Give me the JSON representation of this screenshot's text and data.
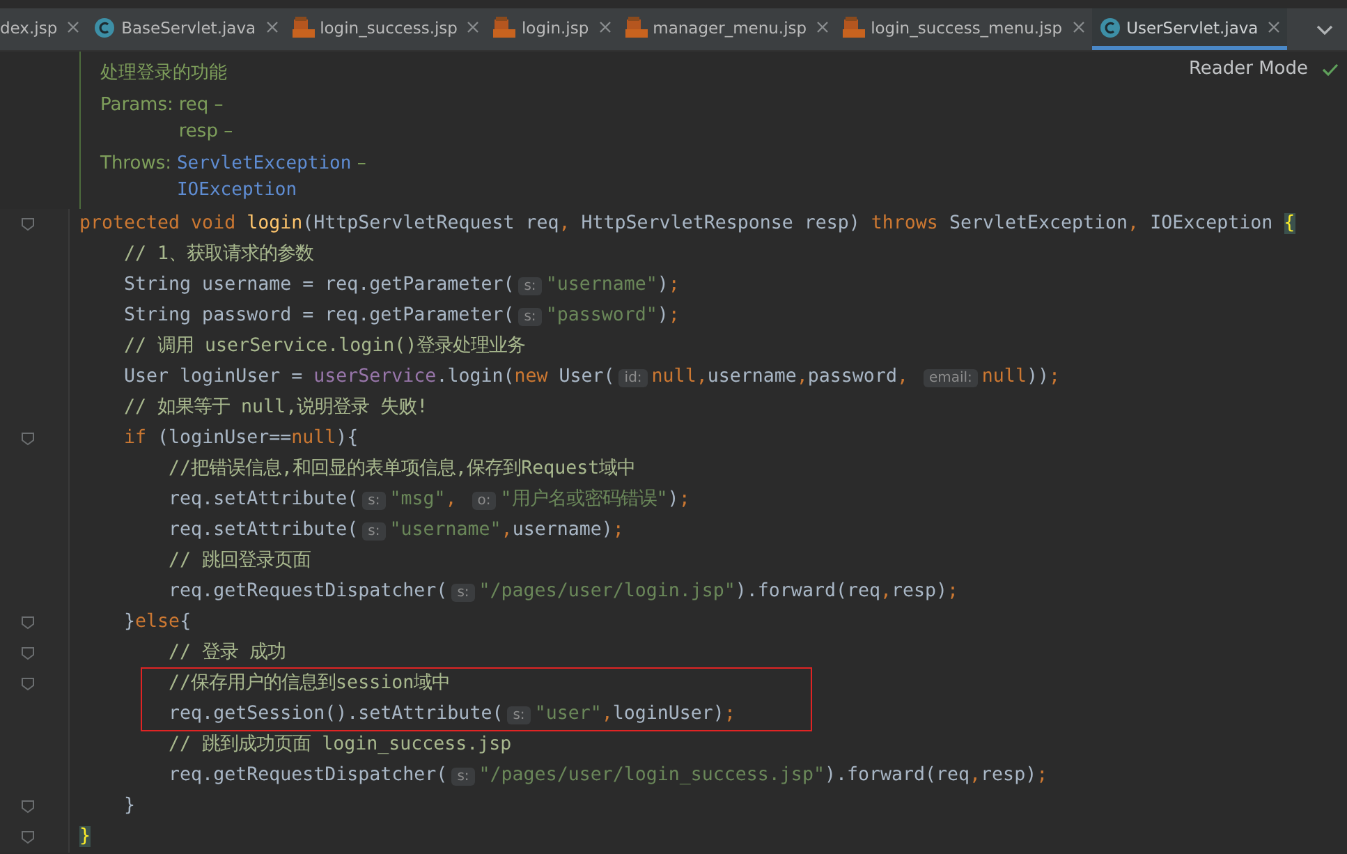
{
  "tabs": [
    {
      "label": "dex.jsp",
      "kind": "plain",
      "selected": false
    },
    {
      "label": "BaseServlet.java",
      "kind": "java",
      "selected": false
    },
    {
      "label": "login_success.jsp",
      "kind": "jsp",
      "selected": false
    },
    {
      "label": "login.jsp",
      "kind": "jsp",
      "selected": false
    },
    {
      "label": "manager_menu.jsp",
      "kind": "jsp",
      "selected": false
    },
    {
      "label": "login_success_menu.jsp",
      "kind": "jsp",
      "selected": false
    },
    {
      "label": "UserServlet.java",
      "kind": "java",
      "selected": true
    }
  ],
  "reader_mode": "Reader Mode",
  "doc": {
    "summary": "处理登录的功能",
    "params_label": "Params:",
    "params": [
      "req –",
      "resp –"
    ],
    "throws_label": "Throws:",
    "throws": [
      {
        "name": "ServletException",
        "suffix": " –"
      },
      {
        "name": "IOException",
        "suffix": ""
      }
    ]
  },
  "lines": [
    {
      "fold": true,
      "boxed": false,
      "tokens": [
        {
          "kind": "kw",
          "text": "protected void "
        },
        {
          "kind": "fn",
          "text": "login"
        },
        {
          "kind": "plain",
          "text": "(HttpServletRequest req"
        },
        {
          "kind": "punct",
          "text": ", "
        },
        {
          "kind": "plain",
          "text": "HttpServletResponse resp) "
        },
        {
          "kind": "kw",
          "text": "throws "
        },
        {
          "kind": "plain",
          "text": "ServletException"
        },
        {
          "kind": "punct",
          "text": ", "
        },
        {
          "kind": "plain",
          "text": "IOException "
        },
        {
          "kind": "match",
          "text": "{"
        }
      ]
    },
    {
      "fold": false,
      "boxed": false,
      "tokens": [
        {
          "kind": "cm",
          "text": "    // 1、获取请求的参数"
        }
      ]
    },
    {
      "fold": false,
      "boxed": false,
      "tokens": [
        {
          "kind": "plain",
          "text": "    String username = req.getParameter("
        },
        {
          "kind": "hint",
          "text": "s:"
        },
        {
          "kind": "str",
          "text": "\"username\""
        },
        {
          "kind": "plain",
          "text": ")"
        },
        {
          "kind": "punct",
          "text": ";"
        }
      ]
    },
    {
      "fold": false,
      "boxed": false,
      "tokens": [
        {
          "kind": "plain",
          "text": "    String password = req.getParameter("
        },
        {
          "kind": "hint",
          "text": "s:"
        },
        {
          "kind": "str",
          "text": "\"password\""
        },
        {
          "kind": "plain",
          "text": ")"
        },
        {
          "kind": "punct",
          "text": ";"
        }
      ]
    },
    {
      "fold": false,
      "boxed": false,
      "tokens": [
        {
          "kind": "cm",
          "text": "    // 调用 userService.login()登录处理业务"
        }
      ]
    },
    {
      "fold": false,
      "boxed": false,
      "tokens": [
        {
          "kind": "plain",
          "text": "    User loginUser = "
        },
        {
          "kind": "fld",
          "text": "userService"
        },
        {
          "kind": "plain",
          "text": ".login("
        },
        {
          "kind": "kw",
          "text": "new "
        },
        {
          "kind": "plain",
          "text": "User("
        },
        {
          "kind": "hint",
          "text": "id:"
        },
        {
          "kind": "kw",
          "text": "null"
        },
        {
          "kind": "punct",
          "text": ","
        },
        {
          "kind": "plain",
          "text": "username"
        },
        {
          "kind": "punct",
          "text": ","
        },
        {
          "kind": "plain",
          "text": "password"
        },
        {
          "kind": "punct",
          "text": ", "
        },
        {
          "kind": "hint",
          "text": "email:"
        },
        {
          "kind": "kw",
          "text": "null"
        },
        {
          "kind": "plain",
          "text": "))"
        },
        {
          "kind": "punct",
          "text": ";"
        }
      ]
    },
    {
      "fold": false,
      "boxed": false,
      "tokens": [
        {
          "kind": "cm",
          "text": "    // 如果等于 null,说明登录 失败!"
        }
      ]
    },
    {
      "fold": true,
      "boxed": false,
      "tokens": [
        {
          "kind": "kw",
          "text": "    if "
        },
        {
          "kind": "plain",
          "text": "(loginUser=="
        },
        {
          "kind": "kw",
          "text": "null"
        },
        {
          "kind": "plain",
          "text": "){"
        }
      ]
    },
    {
      "fold": false,
      "boxed": false,
      "tokens": [
        {
          "kind": "cm",
          "text": "        //把错误信息,和回显的表单项信息,保存到Request域中"
        }
      ]
    },
    {
      "fold": false,
      "boxed": false,
      "tokens": [
        {
          "kind": "plain",
          "text": "        req.setAttribute("
        },
        {
          "kind": "hint",
          "text": "s:"
        },
        {
          "kind": "str",
          "text": "\"msg\""
        },
        {
          "kind": "punct",
          "text": ", "
        },
        {
          "kind": "hint",
          "text": "o:"
        },
        {
          "kind": "str",
          "text": "\"用户名或密码错误\""
        },
        {
          "kind": "plain",
          "text": ")"
        },
        {
          "kind": "punct",
          "text": ";"
        }
      ]
    },
    {
      "fold": false,
      "boxed": false,
      "tokens": [
        {
          "kind": "plain",
          "text": "        req.setAttribute("
        },
        {
          "kind": "hint",
          "text": "s:"
        },
        {
          "kind": "str",
          "text": "\"username\""
        },
        {
          "kind": "punct",
          "text": ","
        },
        {
          "kind": "plain",
          "text": "username)"
        },
        {
          "kind": "punct",
          "text": ";"
        }
      ]
    },
    {
      "fold": false,
      "boxed": false,
      "tokens": [
        {
          "kind": "cm",
          "text": "        // 跳回登录页面"
        }
      ]
    },
    {
      "fold": false,
      "boxed": false,
      "tokens": [
        {
          "kind": "plain",
          "text": "        req.getRequestDispatcher("
        },
        {
          "kind": "hint",
          "text": "s:"
        },
        {
          "kind": "str",
          "text": "\"/pages/user/login.jsp\""
        },
        {
          "kind": "plain",
          "text": ").forward(req"
        },
        {
          "kind": "punct",
          "text": ","
        },
        {
          "kind": "plain",
          "text": "resp)"
        },
        {
          "kind": "punct",
          "text": ";"
        }
      ]
    },
    {
      "fold": true,
      "boxed": false,
      "tokens": [
        {
          "kind": "plain",
          "text": "    }"
        },
        {
          "kind": "kw",
          "text": "else"
        },
        {
          "kind": "plain",
          "text": "{"
        }
      ]
    },
    {
      "fold": true,
      "boxed": false,
      "tokens": [
        {
          "kind": "cm",
          "text": "        // 登录 成功"
        }
      ]
    },
    {
      "fold": true,
      "boxed": true,
      "tokens": [
        {
          "kind": "cm",
          "text": "        //保存用户的信息到session域中"
        }
      ]
    },
    {
      "fold": false,
      "boxed": true,
      "tokens": [
        {
          "kind": "plain",
          "text": "        req.getSession().setAttribute("
        },
        {
          "kind": "hint",
          "text": "s:"
        },
        {
          "kind": "str",
          "text": "\"user\""
        },
        {
          "kind": "punct",
          "text": ","
        },
        {
          "kind": "plain",
          "text": "loginUser)"
        },
        {
          "kind": "punct",
          "text": ";"
        }
      ]
    },
    {
      "fold": false,
      "boxed": false,
      "tokens": [
        {
          "kind": "cm",
          "text": "        // 跳到成功页面 login_success.jsp"
        }
      ]
    },
    {
      "fold": false,
      "boxed": false,
      "tokens": [
        {
          "kind": "plain",
          "text": "        req.getRequestDispatcher("
        },
        {
          "kind": "hint",
          "text": "s:"
        },
        {
          "kind": "str",
          "text": "\"/pages/user/login_success.jsp\""
        },
        {
          "kind": "plain",
          "text": ").forward(req"
        },
        {
          "kind": "punct",
          "text": ","
        },
        {
          "kind": "plain",
          "text": "resp)"
        },
        {
          "kind": "punct",
          "text": ";"
        }
      ]
    },
    {
      "fold": true,
      "boxed": false,
      "tokens": [
        {
          "kind": "plain",
          "text": "    }"
        }
      ]
    },
    {
      "fold": true,
      "boxed": false,
      "tokens": [
        {
          "kind": "match",
          "text": "}"
        }
      ]
    }
  ]
}
